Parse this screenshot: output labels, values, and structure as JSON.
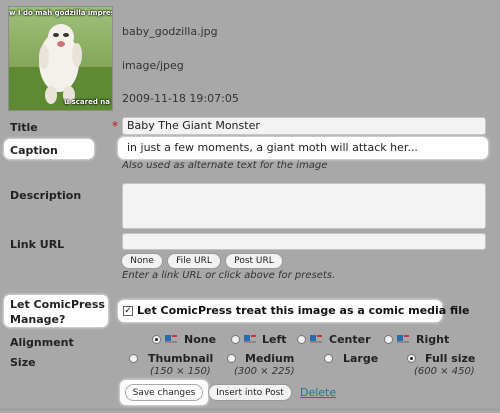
{
  "thumbnail": {
    "caption_top": "w I do mah godzilla impresshun",
    "caption_bottom": "u scared na"
  },
  "file": {
    "name": "baby_godzilla.jpg",
    "mime": "image/jpeg",
    "date": "2009-11-18 19:07:05"
  },
  "fields": {
    "title_label": "Title",
    "title_value": "Baby The Giant Monster",
    "required_mark": "*",
    "caption_label": "Caption",
    "caption_value": "in just a few moments, a giant moth will attack her...",
    "caption_help": "Also used as alternate text for the image",
    "description_label": "Description",
    "description_value": "",
    "link_label": "Link URL",
    "link_value": "",
    "link_buttons": [
      "None",
      "File URL",
      "Post URL"
    ],
    "link_help": "Enter a link URL or click above for presets."
  },
  "comicpress": {
    "label_line1": "Let ComicPress",
    "label_line2": "Manage?",
    "checkbox_label": "Let ComicPress treat this image as a comic media file",
    "checked": true
  },
  "alignment": {
    "label": "Alignment",
    "options": [
      "None",
      "Left",
      "Center",
      "Right"
    ],
    "selected": "None"
  },
  "size": {
    "label": "Size",
    "options": [
      {
        "name": "Thumbnail",
        "dims": "(150 × 150)"
      },
      {
        "name": "Medium",
        "dims": "(300 × 225)"
      },
      {
        "name": "Large",
        "dims": ""
      },
      {
        "name": "Full size",
        "dims": "(600 × 450)"
      }
    ],
    "selected": "Full size"
  },
  "actions": {
    "save": "Save changes",
    "insert": "Insert into Post",
    "delete": "Delete"
  }
}
